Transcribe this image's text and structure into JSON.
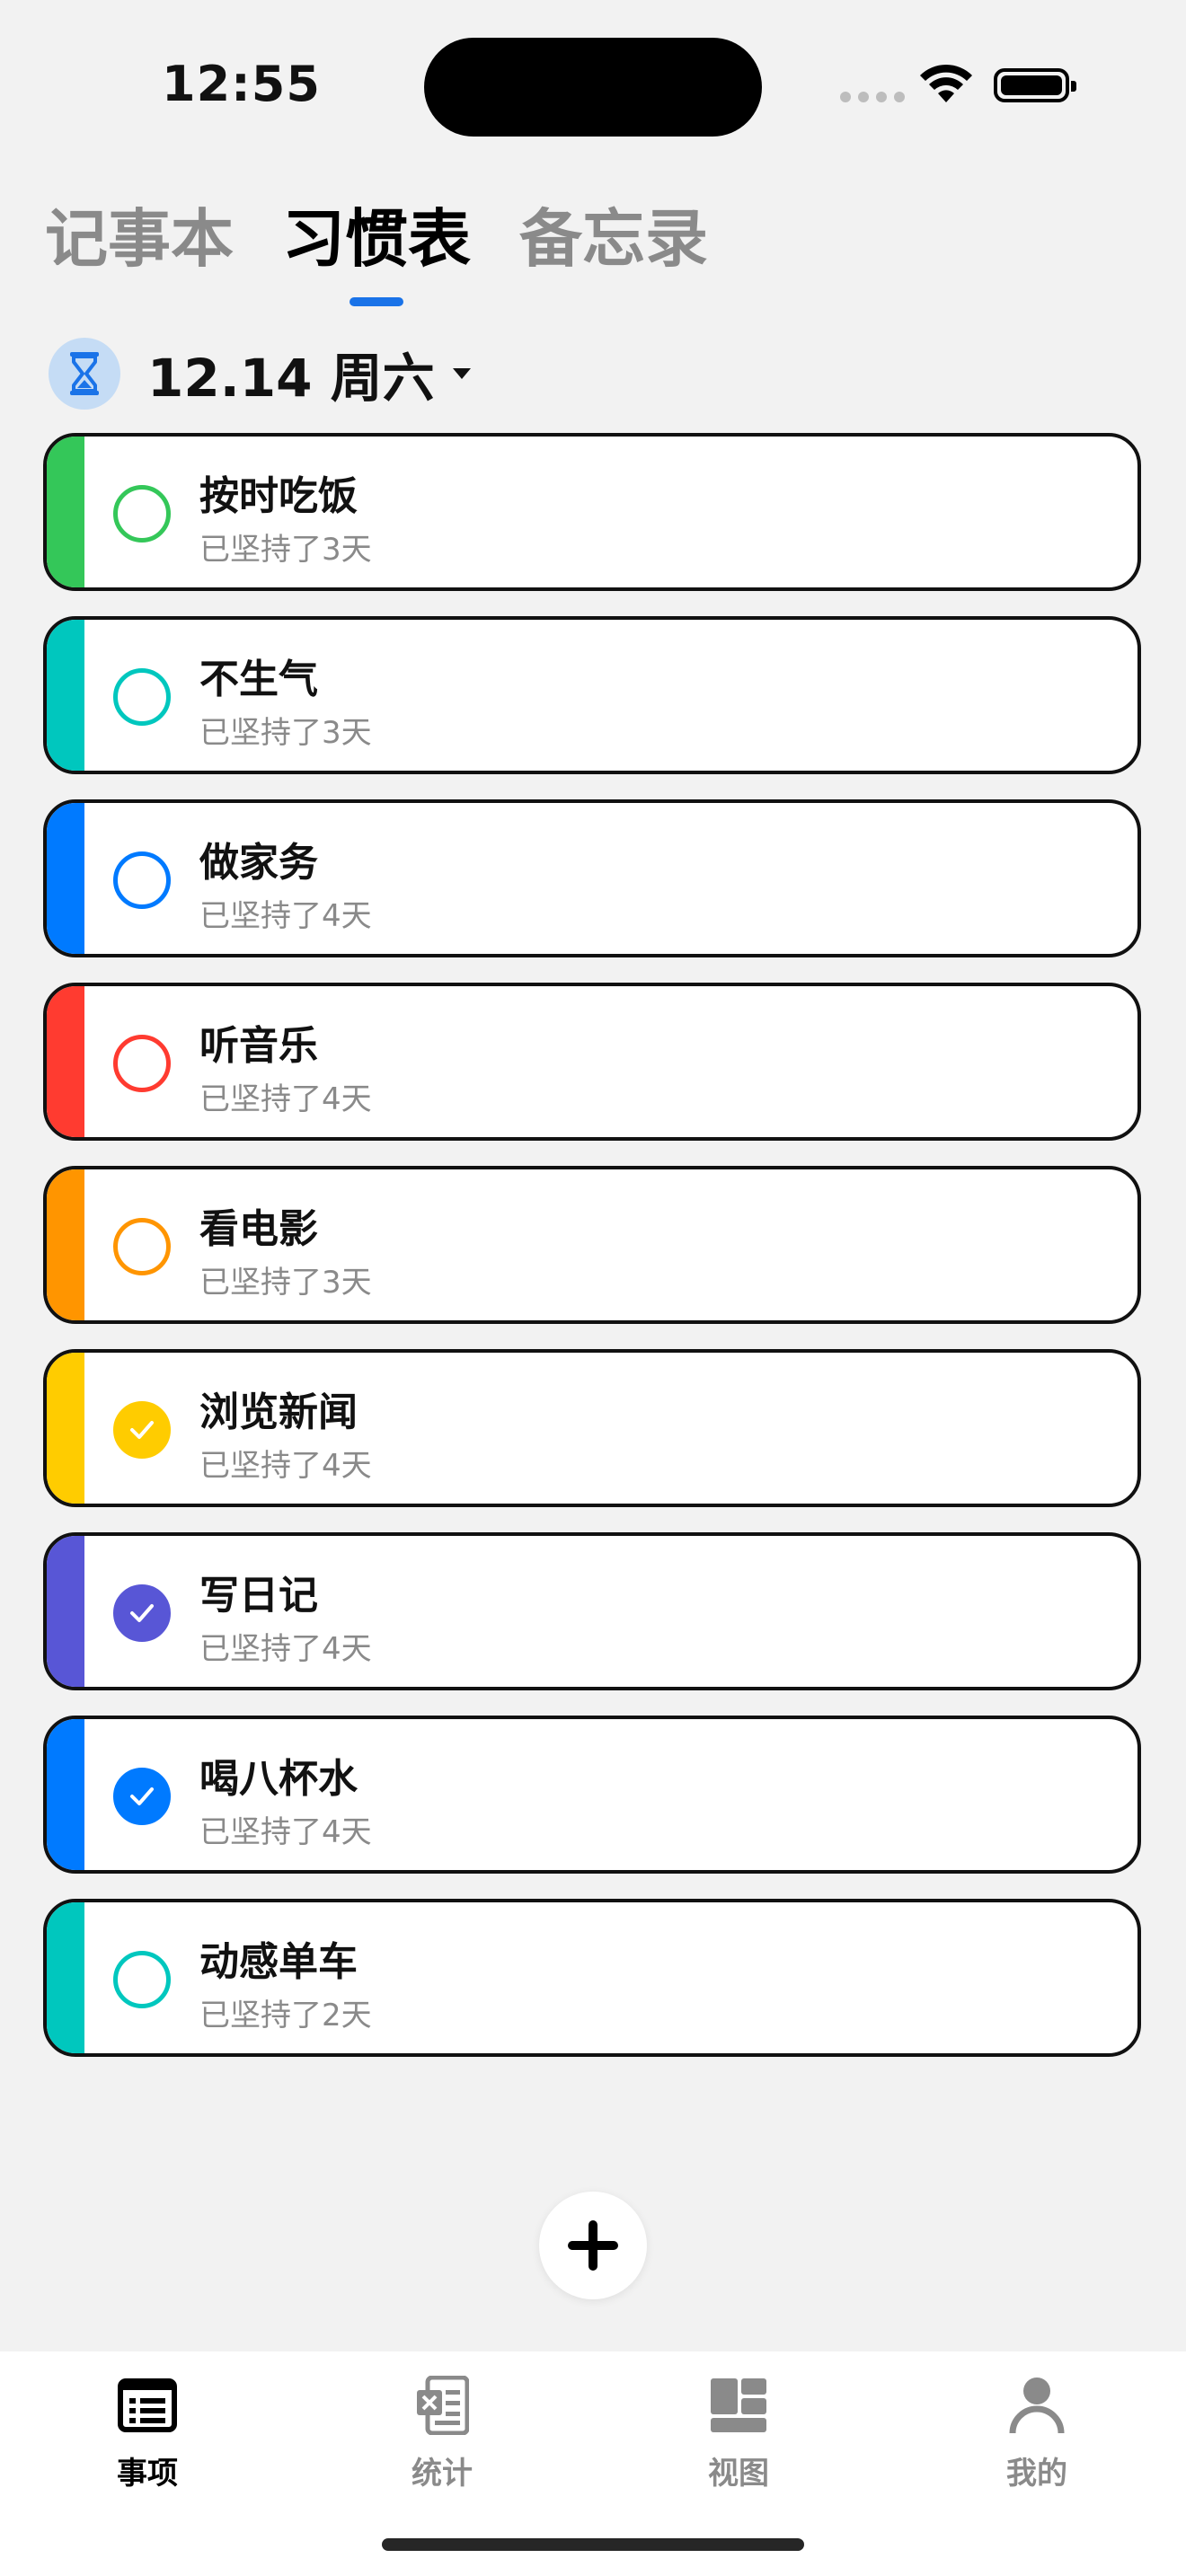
{
  "status": {
    "time": "12:55"
  },
  "tabs": [
    {
      "label": "记事本",
      "active": false
    },
    {
      "label": "习惯表",
      "active": true
    },
    {
      "label": "备忘录",
      "active": false
    }
  ],
  "date": {
    "label": "12.14 周六",
    "icon": "hourglass-icon"
  },
  "habits": [
    {
      "name": "按时吃饭",
      "streak": "已坚持了3天",
      "color": "#34c759",
      "done": false
    },
    {
      "name": "不生气",
      "streak": "已坚持了3天",
      "color": "#00c7be",
      "done": false
    },
    {
      "name": "做家务",
      "streak": "已坚持了4天",
      "color": "#007aff",
      "done": false
    },
    {
      "name": "听音乐",
      "streak": "已坚持了4天",
      "color": "#ff3b30",
      "done": false
    },
    {
      "name": "看电影",
      "streak": "已坚持了3天",
      "color": "#ff9500",
      "done": false
    },
    {
      "name": "浏览新闻",
      "streak": "已坚持了4天",
      "color": "#ffcc00",
      "done": true
    },
    {
      "name": "写日记",
      "streak": "已坚持了4天",
      "color": "#5856d6",
      "done": true
    },
    {
      "name": "喝八杯水",
      "streak": "已坚持了4天",
      "color": "#007aff",
      "done": true
    },
    {
      "name": "动感单车",
      "streak": "已坚持了2天",
      "color": "#00c7be",
      "done": false
    }
  ],
  "add_button": {
    "icon": "plus-icon"
  },
  "bottom_nav": [
    {
      "label": "事项",
      "icon": "list-icon",
      "active": true
    },
    {
      "label": "统计",
      "icon": "spreadsheet-icon",
      "active": false
    },
    {
      "label": "视图",
      "icon": "grid-view-icon",
      "active": false
    },
    {
      "label": "我的",
      "icon": "person-icon",
      "active": false
    }
  ]
}
